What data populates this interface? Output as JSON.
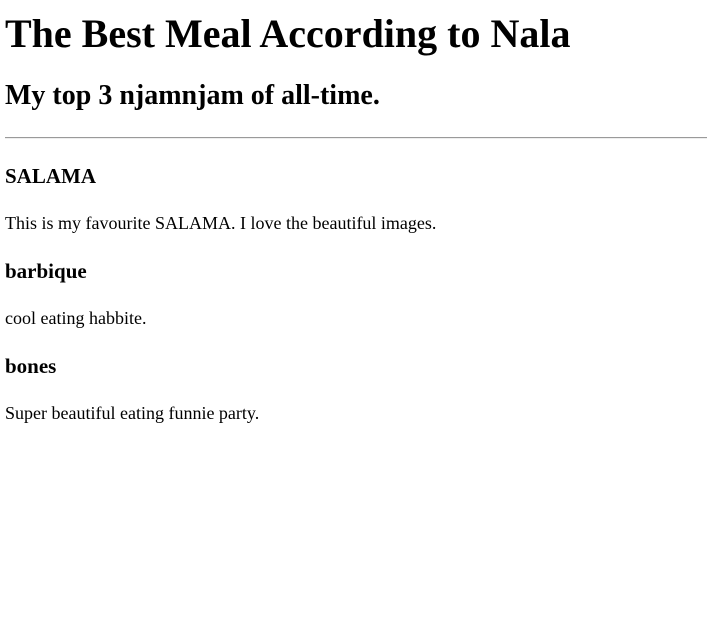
{
  "header": {
    "title": "The Best Meal According to Nala",
    "subtitle": "My top 3 njamnjam of all-time."
  },
  "meals": [
    {
      "name": "SALAMA",
      "description": "This is my favourite SALAMA. I love the beautiful images."
    },
    {
      "name": "barbique",
      "description": "cool eating habbite."
    },
    {
      "name": "bones",
      "description": "Super beautiful eating funnie party."
    }
  ]
}
